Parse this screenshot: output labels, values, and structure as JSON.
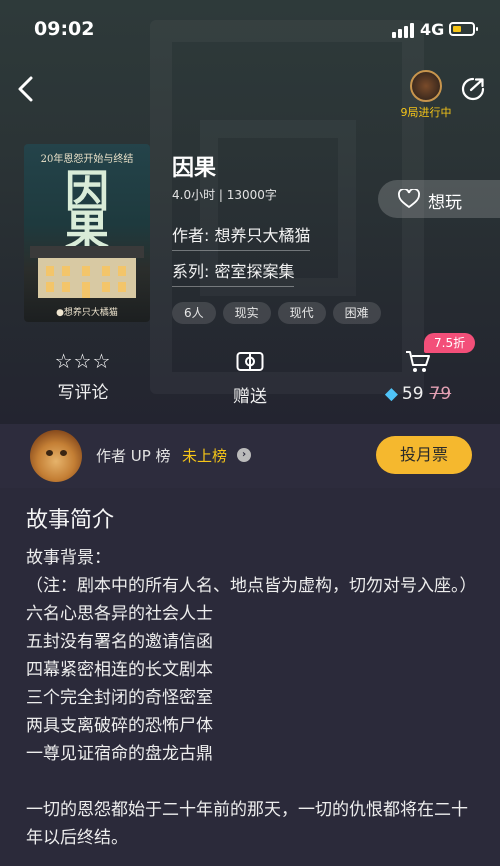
{
  "status_bar": {
    "time": "09:02",
    "network": "4G"
  },
  "header": {
    "in_progress_label": "9局进行中"
  },
  "script": {
    "cover": {
      "tagline": "20年恩怨开始与终结",
      "title_chars": [
        "因",
        "果"
      ],
      "author": "●想养只大橘猫"
    },
    "title": "因果",
    "meta": "4.0小时 | 13000字",
    "author_line": "作者: 想养只大橘猫",
    "series_line": "系列: 密室探案集",
    "want_label": "想玩",
    "tags": [
      "6人",
      "现实",
      "现代",
      "困难"
    ]
  },
  "actions": {
    "review_label": "写评论",
    "gift_label": "赠送",
    "discount": "7.5折",
    "price": "59",
    "original_price": "79"
  },
  "author_rank": {
    "label": "作者 UP 榜",
    "status": "未上榜",
    "vote_button": "投月票"
  },
  "story": {
    "heading": "故事简介",
    "lines": [
      "故事背景：",
      "（注：剧本中的所有人名、地点皆为虚构，切勿对号入座。）",
      "六名心思各异的社会人士",
      "五封没有署名的邀请信函",
      "四幕紧密相连的长文剧本",
      "三个完全封闭的奇怪密室",
      "两具支离破碎的恐怖尸体",
      "一尊见证宿命的盘龙古鼎",
      "",
      "一切的恩怨都始于二十年前的那天，一切的仇恨都将在二十年以后终结。"
    ]
  },
  "colors": {
    "accent_yellow": "#f5c518",
    "discount_pink": "#f34f79",
    "vote_button": "#f5b82e"
  }
}
